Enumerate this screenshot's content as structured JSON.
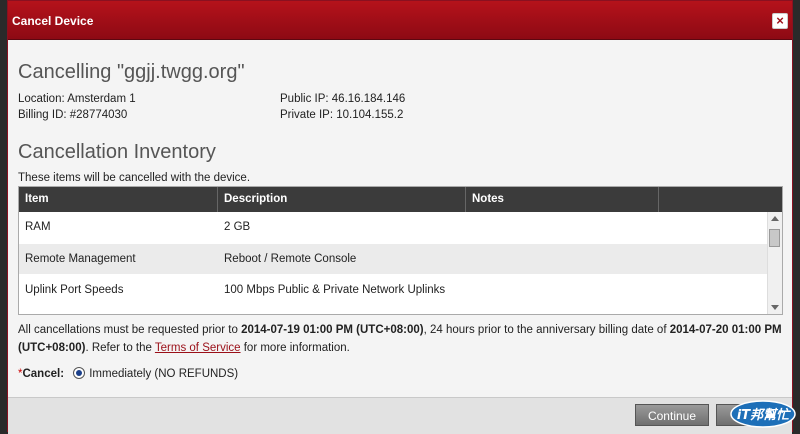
{
  "dialog": {
    "title": "Cancel Device",
    "close_symbol": "×"
  },
  "device": {
    "heading": "Cancelling \"ggjj.twgg.org\"",
    "location": "Location: Amsterdam 1",
    "billing_id": "Billing ID: #28774030",
    "public_ip": "Public IP: 46.16.184.146",
    "private_ip": "Private IP: 10.104.155.2"
  },
  "inventory": {
    "heading": "Cancellation Inventory",
    "intro": "These items will be cancelled with the device.",
    "columns": [
      "Item",
      "Description",
      "Notes"
    ],
    "rows": [
      {
        "item": "RAM",
        "description": "2 GB",
        "notes": ""
      },
      {
        "item": "Remote Management",
        "description": "Reboot / Remote Console",
        "notes": ""
      },
      {
        "item": "Uplink Port Speeds",
        "description": "100 Mbps Public & Private Network Uplinks",
        "notes": ""
      }
    ]
  },
  "notice": {
    "part1": "All cancellations must be requested prior to ",
    "date1": "2014-07-19 01:00 PM (UTC+08:00)",
    "part2": ", 24 hours prior to the anniversary billing date of ",
    "date2": "2014-07-20 01:00 PM (UTC+08:00)",
    "part3": ". Refer to the ",
    "link": "Terms of Service",
    "part4": " for more information."
  },
  "cancel": {
    "asterisk": "*",
    "label": "Cancel:",
    "option": "Immediately (NO REFUNDS)"
  },
  "footer": {
    "continue_label": "Continue",
    "other_label": ""
  },
  "watermark": {
    "text": "iT邦幫忙"
  }
}
